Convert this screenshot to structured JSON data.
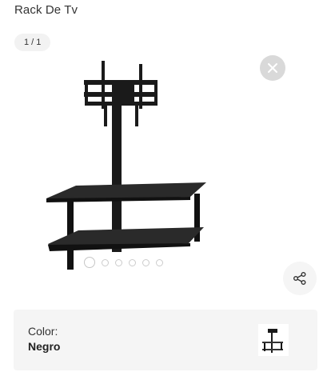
{
  "header": {
    "title": "Rack De Tv"
  },
  "gallery": {
    "counter": "1 / 1",
    "close_icon": "close-icon",
    "share_icon": "share-icon",
    "dots": [
      {
        "active": true
      },
      {
        "active": false
      },
      {
        "active": false
      },
      {
        "active": false
      },
      {
        "active": false
      },
      {
        "active": false
      }
    ]
  },
  "variant": {
    "label": "Color:",
    "value": "Negro"
  },
  "colors": {
    "close_bg": "#d9d9d9",
    "card_bg": "#f5f5f5",
    "product": "#1a1a1a"
  }
}
